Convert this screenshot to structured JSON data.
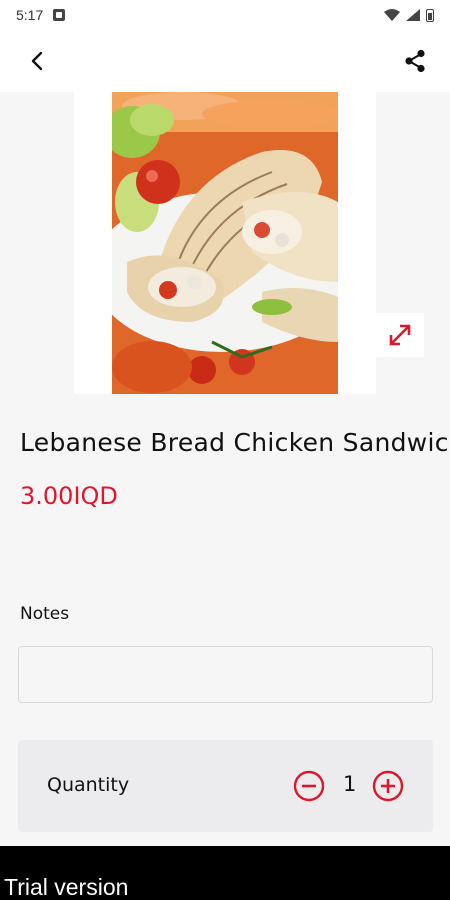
{
  "status_bar": {
    "time": "5:17",
    "icons": [
      "notification-icon",
      "wifi-icon",
      "signal-icon",
      "battery-icon"
    ]
  },
  "app_bar": {
    "back_icon": "chevron-left-icon",
    "share_icon": "share-icon"
  },
  "product": {
    "image_icon": "food-photo",
    "expand_icon": "expand-icon",
    "title": "Lebanese Bread Chicken Sandwich",
    "price": "3.00IQD"
  },
  "notes": {
    "label": "Notes",
    "value": "",
    "placeholder": ""
  },
  "quantity": {
    "label": "Quantity",
    "value": "1",
    "minus_icon": "minus-circle-icon",
    "plus_icon": "plus-circle-icon"
  },
  "footer": {
    "text": "Trial version"
  },
  "colors": {
    "accent": "#e0162b",
    "background": "#f6f6f7",
    "card": "#ececef",
    "banner": "#000000"
  }
}
